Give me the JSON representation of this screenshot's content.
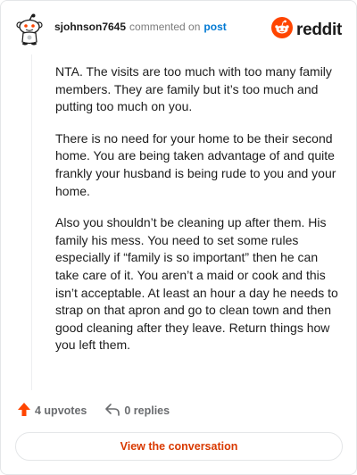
{
  "header": {
    "username": "sjohnson7645",
    "commented_on": "commented on",
    "post_link": "post",
    "brand_word": "reddit"
  },
  "comment": {
    "paragraphs": [
      "NTA. The visits are too much with too many family members. They are family but it’s too much and putting too much on you.",
      "There is no need for your home to be their second home. You are being taken advantage of and quite frankly your husband is being rude to you and your home.",
      "Also you shouldn’t be cleaning up after them. His family his mess. You need to set some rules especially if “family is so important” then he can take care of it. You aren’t a maid or cook and this isn’t acceptable. At least an hour a day he needs to strap on that apron and go to clean town and then good cleaning after they leave. Return things how you left them."
    ]
  },
  "actions": {
    "upvotes": "4 upvotes",
    "replies": "0 replies"
  },
  "cta": {
    "label": "View the conversation"
  },
  "colors": {
    "accent": "#d93900",
    "reddit_orange": "#ff4500",
    "link_blue": "#0079d3"
  },
  "icons": [
    "snoo-avatar-icon",
    "reddit-logo-icon",
    "upvote-arrow-icon",
    "reply-arrow-icon"
  ]
}
